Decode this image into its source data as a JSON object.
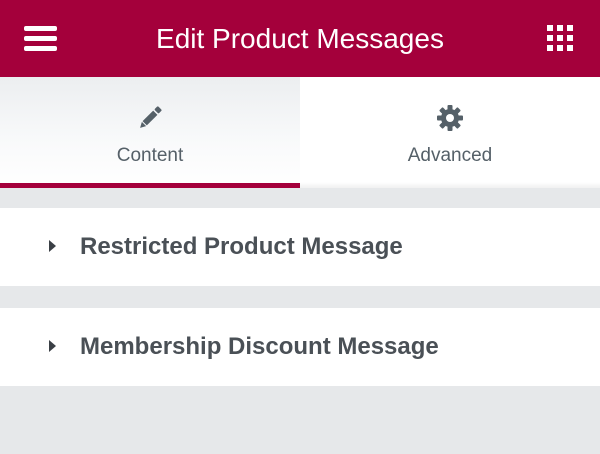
{
  "header": {
    "title": "Edit Product Messages",
    "menu_icon": "hamburger-menu-icon",
    "grid_icon": "apps-grid-icon",
    "background_color": "#a4003b"
  },
  "tabs": [
    {
      "label": "Content",
      "icon": "pencil-icon",
      "active": true
    },
    {
      "label": "Advanced",
      "icon": "gear-icon",
      "active": false
    }
  ],
  "sections": [
    {
      "title": "Restricted Product Message",
      "icon": "caret-right-icon",
      "expanded": false
    },
    {
      "title": "Membership Discount Message",
      "icon": "caret-right-icon",
      "expanded": false
    }
  ],
  "colors": {
    "accent": "#a4003b",
    "tab_label": "#556068",
    "section_title": "#4a5056",
    "panel_background": "#e6e8ea"
  }
}
